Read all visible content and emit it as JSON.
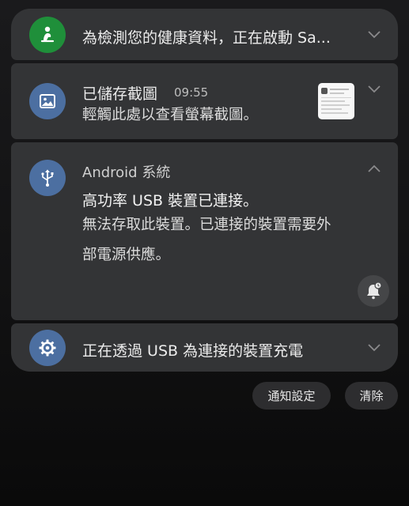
{
  "notifications": [
    {
      "title": "為檢測您的健康資料，正在啟動 Sa...",
      "icon": "health-person-icon",
      "icon_color": "#1f8f3a"
    },
    {
      "title": "已儲存截圖",
      "time": "09:55",
      "body": "輕觸此處以查看螢幕截圖。",
      "icon": "image-icon",
      "icon_color": "#4c6fa1"
    },
    {
      "app_name": "Android 系統",
      "title": "高功率 USB 裝置已連接。",
      "body_line1": "無法存取此裝置。已連接的裝置需要外",
      "body_line2": "部電源供應。",
      "icon": "usb-icon",
      "icon_color": "#4c6fa1",
      "action_icon": "snooze-bell-icon"
    },
    {
      "title": "正在透過 USB 為連接的裝置充電",
      "icon": "gear-icon",
      "icon_color": "#4c6fa1"
    }
  ],
  "actions": {
    "settings_label": "通知設定",
    "clear_label": "清除"
  },
  "colors": {
    "card_bg": "#333436",
    "accent_blue": "#4c6fa1",
    "accent_green": "#1f8f3a"
  }
}
